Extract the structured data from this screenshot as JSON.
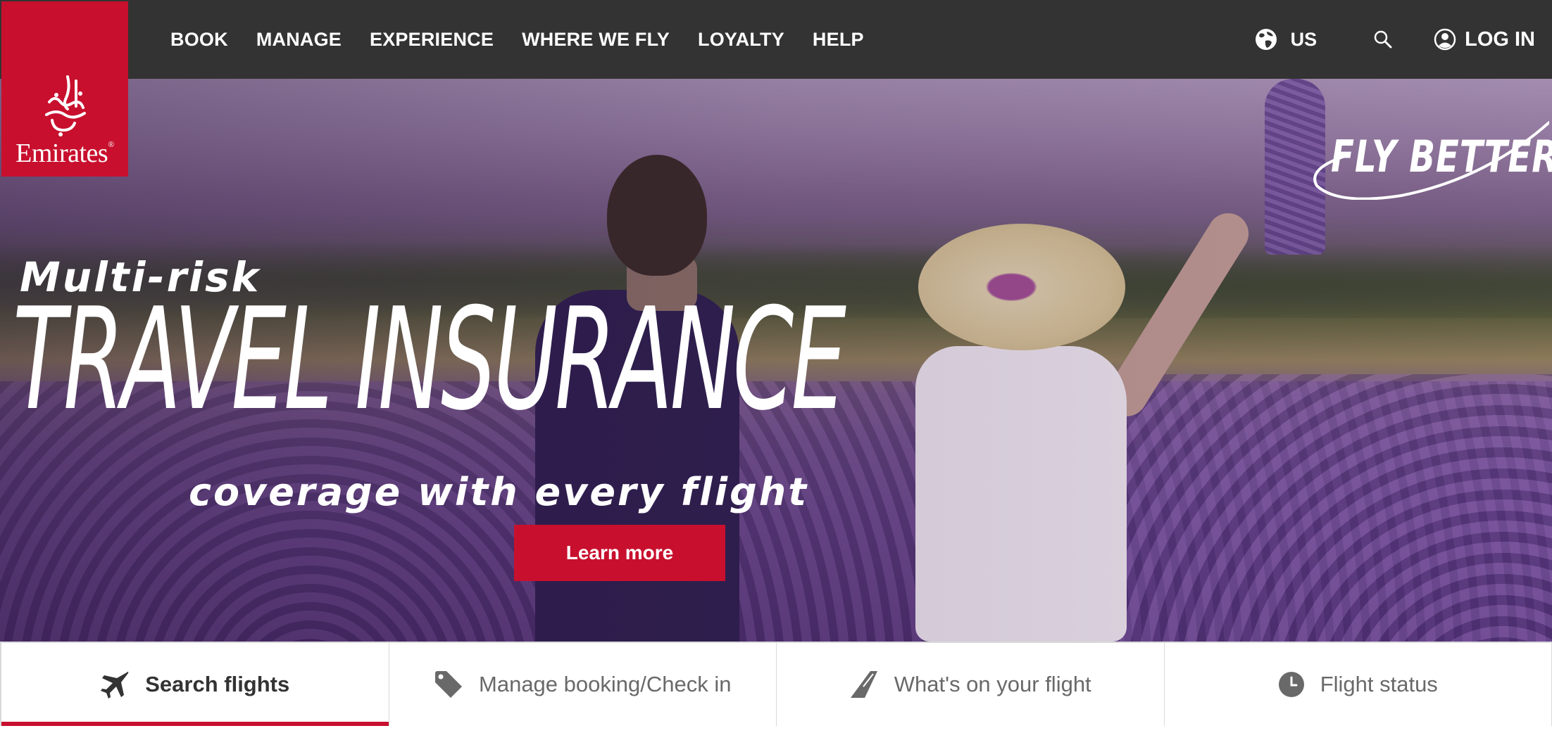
{
  "brand": {
    "name": "Emirates",
    "logo_color": "#c8102e"
  },
  "nav": {
    "items": [
      "BOOK",
      "MANAGE",
      "EXPERIENCE",
      "WHERE WE FLY",
      "LOYALTY",
      "HELP"
    ],
    "region_label": "US",
    "region_icon": "globe-icon",
    "search_icon": "search-icon",
    "login_label": "LOG IN",
    "login_icon": "user-icon"
  },
  "hero": {
    "kicker": "Multi-risk",
    "title": "TRAVEL INSURANCE",
    "subtitle": "coverage with every flight",
    "cta_label": "Learn more",
    "slogan": "FLY BETTER"
  },
  "tabs": [
    {
      "label": "Search flights",
      "icon": "airplane-icon",
      "active": true
    },
    {
      "label": "Manage booking/Check in",
      "icon": "tag-icon",
      "active": false
    },
    {
      "label": "What's on your flight",
      "icon": "tail-fin-icon",
      "active": false
    },
    {
      "label": "Flight status",
      "icon": "clock-icon",
      "active": false
    }
  ],
  "colors": {
    "nav_bg": "#333333",
    "accent": "#c8102e",
    "tab_text": "#696969",
    "tab_active_text": "#333333"
  }
}
